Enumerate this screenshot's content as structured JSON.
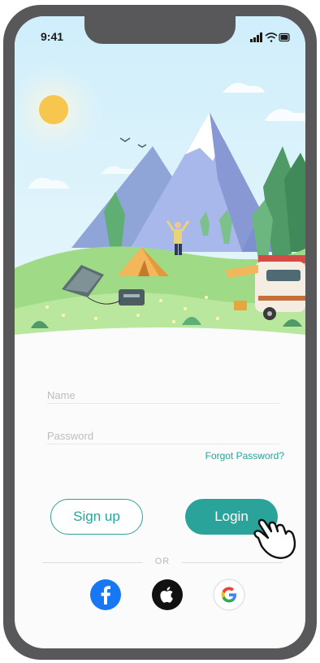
{
  "status_bar": {
    "time": "9:41"
  },
  "login_form": {
    "name_placeholder": "Name",
    "password_placeholder": "Password",
    "forgot_password": "Forgot Password?"
  },
  "actions": {
    "signup_label": "Sign up",
    "login_label": "Login"
  },
  "divider": {
    "text": "OR"
  },
  "social": [
    "facebook-icon",
    "apple-icon",
    "google-icon"
  ],
  "colors": {
    "accent": "#2aa39a",
    "frame": "#58585a"
  }
}
